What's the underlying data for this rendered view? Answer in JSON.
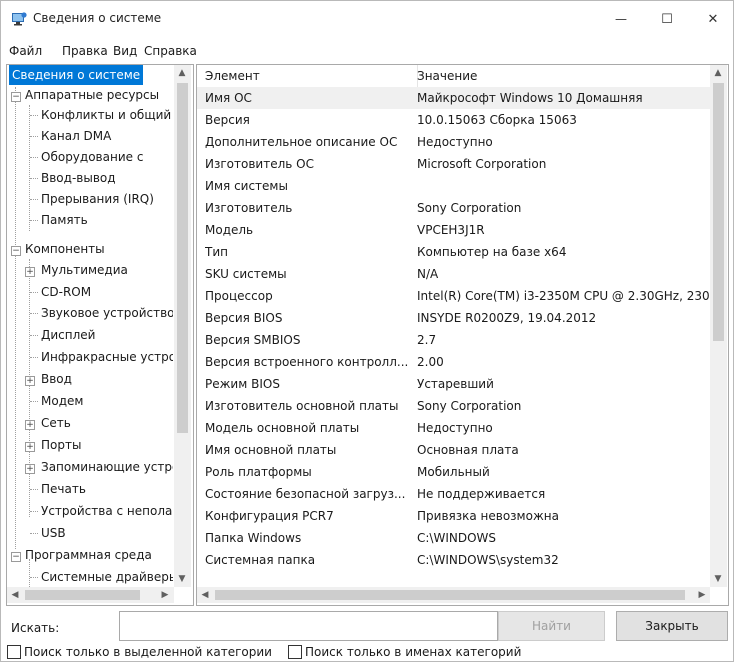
{
  "window": {
    "title": "Сведения о системе",
    "controls": {
      "minimize": "—",
      "maximize": "☐",
      "close": "✕"
    }
  },
  "menu": [
    {
      "id": "file",
      "label": "Файл"
    },
    {
      "id": "edit",
      "label": "Правка"
    },
    {
      "id": "view",
      "label": "Вид"
    },
    {
      "id": "help",
      "label": "Справка"
    }
  ],
  "tree": {
    "root": "Сведения о системе",
    "hardware": {
      "label": "Аппаратные ресурсы",
      "children": [
        "Конфликты и общий доступ",
        "Канал DMA",
        "Оборудование с",
        "Ввод-вывод",
        "Прерывания (IRQ)",
        "Память"
      ]
    },
    "components": {
      "label": "Компоненты",
      "children": [
        "Мультимедиа",
        "CD-ROM",
        "Звуковое устройство",
        "Дисплей",
        "Инфракрасные устройства",
        "Ввод",
        "Модем",
        "Сеть",
        "Порты",
        "Запоминающие устройства",
        "Печать",
        "Устройства с неполадками",
        "USB"
      ]
    },
    "software": {
      "label": "Программная среда",
      "children": [
        "Системные драйверы"
      ]
    }
  },
  "table": {
    "headers": {
      "element": "Элемент",
      "value": "Значение"
    },
    "rows": [
      {
        "element": "Имя ОС",
        "value": "Майкрософт Windows 10 Домашняя"
      },
      {
        "element": "Версия",
        "value": "10.0.15063 Сборка 15063"
      },
      {
        "element": "Дополнительное описание ОС",
        "value": "Недоступно"
      },
      {
        "element": "Изготовитель ОС",
        "value": "Microsoft Corporation"
      },
      {
        "element": "Имя системы",
        "value": ""
      },
      {
        "element": "Изготовитель",
        "value": "Sony Corporation"
      },
      {
        "element": "Модель",
        "value": "VPCEH3J1R"
      },
      {
        "element": "Тип",
        "value": "Компьютер на базе x64"
      },
      {
        "element": "SKU системы",
        "value": "N/A"
      },
      {
        "element": "Процессор",
        "value": "Intel(R) Core(TM) i3-2350M CPU @ 2.30GHz, 230"
      },
      {
        "element": "Версия BIOS",
        "value": "INSYDE R0200Z9, 19.04.2012"
      },
      {
        "element": "Версия SMBIOS",
        "value": "2.7"
      },
      {
        "element": "Версия встроенного контролл...",
        "value": "2.00"
      },
      {
        "element": "Режим BIOS",
        "value": "Устаревший"
      },
      {
        "element": "Изготовитель основной платы",
        "value": "Sony Corporation"
      },
      {
        "element": "Модель основной платы",
        "value": "Недоступно"
      },
      {
        "element": "Имя основной платы",
        "value": "Основная плата"
      },
      {
        "element": "Роль платформы",
        "value": "Мобильный"
      },
      {
        "element": "Состояние безопасной загруз...",
        "value": "Не поддерживается"
      },
      {
        "element": "Конфигурация PCR7",
        "value": "Привязка невозможна"
      },
      {
        "element": "Папка Windows",
        "value": "C:\\WINDOWS"
      },
      {
        "element": "Системная папка",
        "value": "C:\\WINDOWS\\system32"
      }
    ]
  },
  "search": {
    "label": "Искать:",
    "value": "",
    "find_button": "Найти",
    "close_button": "Закрыть",
    "option_selected_category": "Поиск только в выделенной категории",
    "option_category_names": "Поиск только в именах категорий"
  },
  "colors": {
    "selection": "#0078d7",
    "row_highlight": "#f0f0f0",
    "border": "#a9a9a9"
  },
  "icons": {
    "app": "system-information-icon",
    "expand": "plus-box-icon",
    "collapse": "minus-box-icon"
  }
}
